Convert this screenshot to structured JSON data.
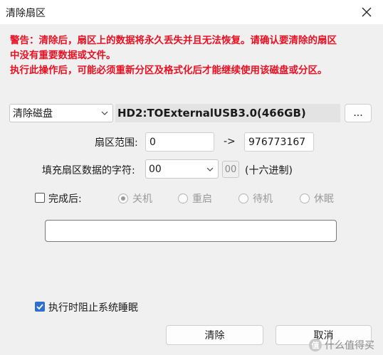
{
  "window": {
    "title": "清除扇区",
    "close_glyph": "✕"
  },
  "warning": {
    "line1": "警告：清除后，扇区上的数据将永久丢失并且无法恢复。请确认要清除的扇区",
    "line2": "中没有重要数据或文件。",
    "line3": "执行此操作后，可能必须重新分区及格式化后才能继续使用该磁盘或分区。"
  },
  "disk": {
    "mode_selected": "清除磁盘",
    "name": "HD2:TOExternalUSB3.0(466GB)",
    "browse_label": "..."
  },
  "range": {
    "label": "扇区范围:",
    "start": "0",
    "arrow": "->",
    "end": "976773167"
  },
  "fill": {
    "label": "填充扇区数据的字符:",
    "selected": "00",
    "hex_value": "00",
    "hex_note": "(十六进制)"
  },
  "after": {
    "checkbox_label": "完成后:",
    "checked": false,
    "options": [
      {
        "label": "关机",
        "selected": true
      },
      {
        "label": "重启",
        "selected": false
      },
      {
        "label": "待机",
        "selected": false
      },
      {
        "label": "休眠",
        "selected": false
      }
    ]
  },
  "status_text": "",
  "prevent_sleep": {
    "label": "执行时阻止系统睡眠",
    "checked": true
  },
  "buttons": {
    "clear": "清除",
    "cancel": "取消"
  },
  "watermark": {
    "badge": "值",
    "text": "什么值得买"
  },
  "colors": {
    "warning": "#e81123",
    "accent": "#2f6fcf"
  }
}
